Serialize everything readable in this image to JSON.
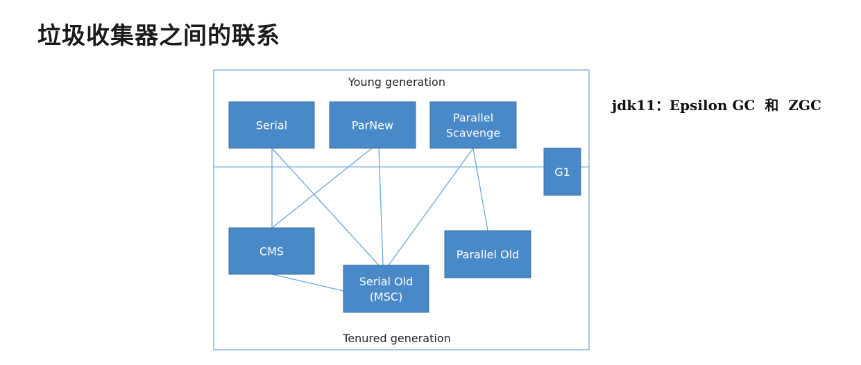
{
  "title": "垃圾收集器之间的联系",
  "side_note": "jdk11：Epsilon GC  和  ZGC",
  "regions": {
    "young": "Young generation",
    "tenured": "Tenured generation"
  },
  "collectors": {
    "serial": [
      "Serial"
    ],
    "parnew": [
      "ParNew"
    ],
    "parallel_scavenge": [
      "Parallel",
      "Scavenge"
    ],
    "g1": [
      "G1"
    ],
    "cms": [
      "CMS"
    ],
    "serial_old": [
      "Serial Old",
      "(MSC)"
    ],
    "parallel_old": [
      "Parallel Old"
    ]
  },
  "links": [
    [
      "serial",
      "cms"
    ],
    [
      "serial",
      "serial_old"
    ],
    [
      "parnew",
      "cms"
    ],
    [
      "parnew",
      "serial_old"
    ],
    [
      "parallel_scavenge",
      "serial_old"
    ],
    [
      "parallel_scavenge",
      "parallel_old"
    ],
    [
      "cms",
      "serial_old"
    ]
  ]
}
